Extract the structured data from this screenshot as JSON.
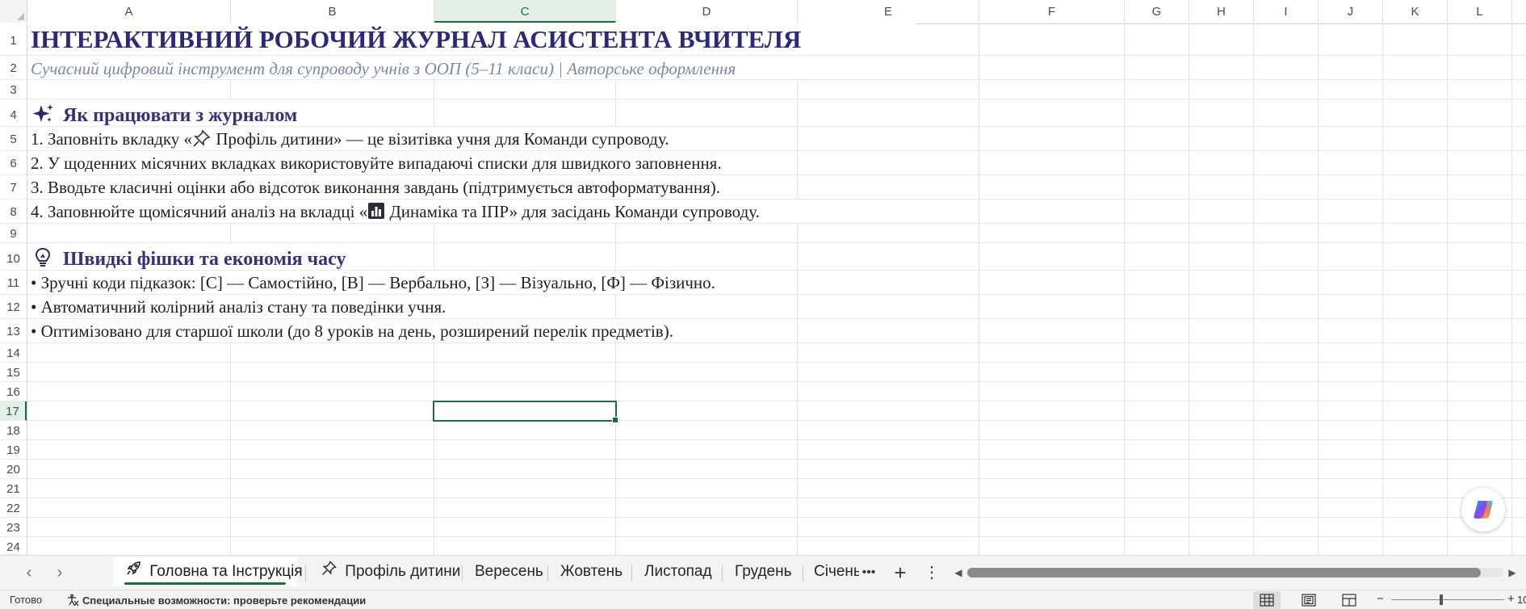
{
  "columns": [
    "A",
    "B",
    "C",
    "D",
    "E",
    "F",
    "G",
    "H",
    "I",
    "J",
    "K",
    "L"
  ],
  "selected_column": "C",
  "selected_row": "17",
  "rows": [
    "1",
    "2",
    "3",
    "4",
    "5",
    "6",
    "7",
    "8",
    "9",
    "10",
    "11",
    "12",
    "13",
    "14",
    "15",
    "16",
    "17",
    "18",
    "19",
    "20",
    "21",
    "22",
    "23",
    "24"
  ],
  "sheet": {
    "title": "ІНТЕРАКТИВНИЙ РОБОЧИЙ ЖУРНАЛ АСИСТЕНТА ВЧИТЕЛЯ",
    "subtitle": "Сучасний цифровий інструмент для супроводу учнів з ООП (5–11 класи) | Авторське оформлення",
    "section1_title": "Як працювати з журналом",
    "section1_icon": "sparkles-icon",
    "step1_pre": "1. Заповніть вкладку «",
    "step1_icon": "pushpin-icon",
    "step1_post": " Профіль дитини» — це візитівка учня для Команди супроводу.",
    "step2": "2. У щоденних місячних вкладках використовуйте випадаючі списки для швидкого заповнення.",
    "step3": "3. Вводьте класичні оцінки або відсоток виконання завдань (підтримується автоформатування).",
    "step4_pre": "4. Заповнюйте щомісячний аналіз на вкладці «",
    "step4_icon": "bar-chart-icon",
    "step4_post": " Динаміка та ІПР» для засідань Команди супроводу.",
    "section2_title": "Швидкі фішки та економія часу",
    "section2_icon": "lightbulb-icon",
    "tip1": "• Зручні коди підказок: [С] — Самостійно, [В] — Вербально, [З] — Візуально, [Ф] — Фізично.",
    "tip2": "• Автоматичний колірний аналіз стану та поведінки учня.",
    "tip3": "• Оптимізовано для старшої школи (до 8 уроків на день, розширений перелік предметів)."
  },
  "tabs": {
    "active": "Головна та Інструкція",
    "active_icon": "rocket-icon",
    "profile": "Профіль дитини",
    "profile_icon": "pushpin-icon",
    "m1": "Вересень",
    "m2": "Жовтень",
    "m3": "Листопад",
    "m4": "Грудень",
    "m5": "Січень",
    "more": "•••",
    "add": "+",
    "options": "⋮"
  },
  "status": {
    "ready": "Готово",
    "accessibility": "Специальные возможности: проверьте рекомендации",
    "zoom_minus": "−",
    "zoom_plus": "+",
    "zoom_value": "10"
  },
  "colors": {
    "accent": "#1e6b41",
    "title": "#2a2a7a",
    "subtitle": "#7a8aa0",
    "section": "#3a2f7a"
  }
}
